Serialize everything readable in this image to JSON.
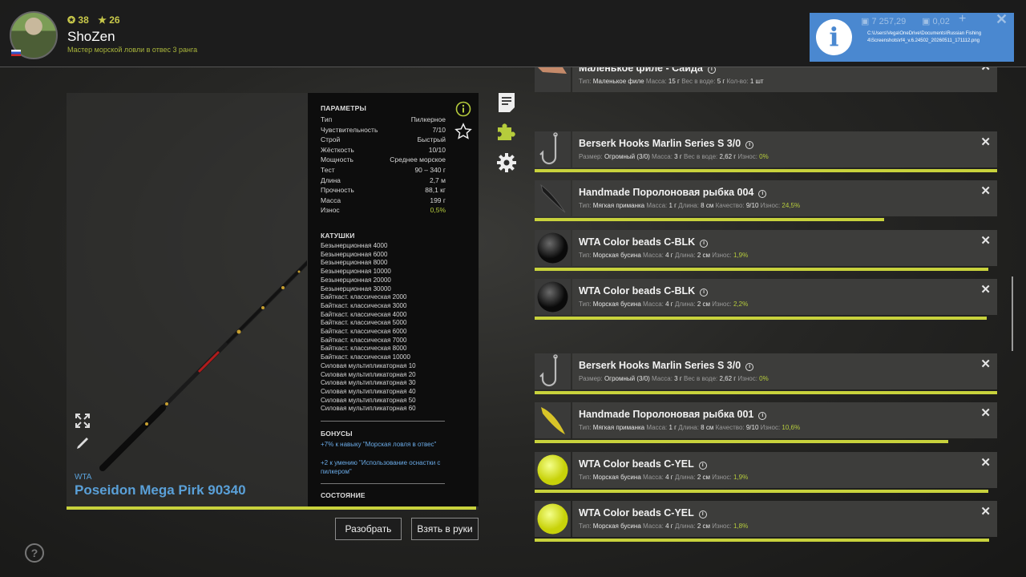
{
  "header": {
    "level": "38",
    "rank_points": "26",
    "username": "ShoZen",
    "rank_title": "Мастер морской ловли в отвес 3 ранга",
    "currency1": "7 257,29",
    "currency2": "0,02",
    "plus": "+",
    "notification_icon": "i",
    "notification_path": "C:\\Users\\Vega\\OneDrive\\Documents\\Russian Fishing 4\\Screenshots\\rf4_v.6.24502_20260511_171112.png",
    "close": "✕"
  },
  "rod": {
    "brand": "WTA",
    "name": "Poseidon Mega Pirk 90340",
    "params_title": "ПАРАМЕТРЫ",
    "params": [
      {
        "k": "Тип",
        "v": "Пилкерное"
      },
      {
        "k": "Чувствительность",
        "v": "7/10"
      },
      {
        "k": "Строй",
        "v": "Быстрый"
      },
      {
        "k": "Жёсткость",
        "v": "10/10"
      },
      {
        "k": "Мощность",
        "v": "Среднее морское"
      },
      {
        "k": "Тест",
        "v": "90 – 340 г"
      },
      {
        "k": "Длина",
        "v": "2,7 м"
      },
      {
        "k": "Прочность",
        "v": "88,1 кг"
      },
      {
        "k": "Масса",
        "v": "199 г"
      },
      {
        "k": "Износ",
        "v": "0,5%"
      }
    ],
    "reels_title": "КАТУШКИ",
    "reels": [
      "Безынерционная 4000",
      "Безынерционная 6000",
      "Безынерционная 8000",
      "Безынерционная 10000",
      "Безынерционная 20000",
      "Безынерционная 30000",
      "Байткаст. классическая 2000",
      "Байткаст. классическая 3000",
      "Байткаст. классическая 4000",
      "Байткаст. классическая 5000",
      "Байткаст. классическая 6000",
      "Байткаст. классическая 7000",
      "Байткаст. классическая 8000",
      "Байткаст. классическая 10000",
      "Силовая мультипликаторная 10",
      "Силовая мультипликаторная 20",
      "Силовая мультипликаторная 30",
      "Силовая мультипликаторная 40",
      "Силовая мультипликаторная 50",
      "Силовая мультипликаторная 60"
    ],
    "bonuses_title": "БОНУСЫ",
    "bonuses": [
      "+7% к навыку \"Морская ловля в отвес\"",
      "+2 к умению \"Использование оснастки с пилкером\""
    ],
    "condition_title": "СОСТОЯНИЕ",
    "condition": 0.995
  },
  "buttons": {
    "disassemble": "Разобрать",
    "take": "Взять в руки"
  },
  "tackle": [
    {
      "name": "Маленькое филе - Сайда",
      "thumb": "fillet",
      "stats": [
        [
          "Тип:",
          "Маленькое филе"
        ],
        [
          "Масса:",
          "15 г"
        ],
        [
          "Вес в воде:",
          "5 г"
        ],
        [
          "Кол-во:",
          "1 шт"
        ]
      ],
      "wear": null,
      "condition": null
    },
    {
      "name": "Berserk Hooks Marlin Series S 3/0",
      "thumb": "hook",
      "stats": [
        [
          "Размер:",
          "Огромный (3/0)"
        ],
        [
          "Масса:",
          "3 г"
        ],
        [
          "Вес в воде:",
          "2,62 г"
        ]
      ],
      "wear": "0%",
      "condition": 1.0
    },
    {
      "name": "Handmade Поролоновая рыбка 004",
      "thumb": "dark-lure",
      "stats": [
        [
          "Тип:",
          "Мягкая приманка"
        ],
        [
          "Масса:",
          "1 г"
        ],
        [
          "Длина:",
          "8 см"
        ],
        [
          "Качество:",
          "9/10"
        ]
      ],
      "wear": "24,5%",
      "condition": 0.755
    },
    {
      "name": "WTA Color beads C-BLK",
      "thumb": "black-bead",
      "stats": [
        [
          "Тип:",
          "Морская бусина"
        ],
        [
          "Масса:",
          "4 г"
        ],
        [
          "Длина:",
          "2 см"
        ]
      ],
      "wear": "1,9%",
      "condition": 0.981
    },
    {
      "name": "WTA Color beads C-BLK",
      "thumb": "black-bead",
      "stats": [
        [
          "Тип:",
          "Морская бусина"
        ],
        [
          "Масса:",
          "4 г"
        ],
        [
          "Длина:",
          "2 см"
        ]
      ],
      "wear": "2,2%",
      "condition": 0.978
    },
    {
      "name": "Berserk Hooks Marlin Series S 3/0",
      "thumb": "hook",
      "stats": [
        [
          "Размер:",
          "Огромный (3/0)"
        ],
        [
          "Масса:",
          "3 г"
        ],
        [
          "Вес в воде:",
          "2,62 г"
        ]
      ],
      "wear": "0%",
      "condition": 1.0
    },
    {
      "name": "Handmade Поролоновая рыбка 001",
      "thumb": "yellow-lure",
      "stats": [
        [
          "Тип:",
          "Мягкая приманка"
        ],
        [
          "Масса:",
          "1 г"
        ],
        [
          "Длина:",
          "8 см"
        ],
        [
          "Качество:",
          "9/10"
        ]
      ],
      "wear": "10,6%",
      "condition": 0.894
    },
    {
      "name": "WTA Color beads C-YEL",
      "thumb": "yellow-bead",
      "stats": [
        [
          "Тип:",
          "Морская бусина"
        ],
        [
          "Масса:",
          "4 г"
        ],
        [
          "Длина:",
          "2 см"
        ]
      ],
      "wear": "1,9%",
      "condition": 0.981
    },
    {
      "name": "WTA Color beads C-YEL",
      "thumb": "yellow-bead",
      "stats": [
        [
          "Тип:",
          "Морская бусина"
        ],
        [
          "Масса:",
          "4 г"
        ],
        [
          "Длина:",
          "2 см"
        ]
      ],
      "wear": "1,8%",
      "condition": 0.982
    }
  ],
  "labels": {
    "wear": "Износ:"
  },
  "colors": {
    "accent": "#c8d23c",
    "link": "#5aa0d8",
    "notification": "#4a88d0"
  }
}
